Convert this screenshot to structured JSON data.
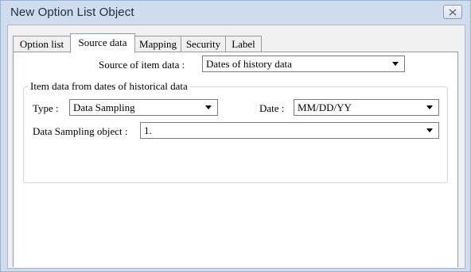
{
  "window": {
    "title": "New Option List Object"
  },
  "tabs": [
    {
      "label": "Option list",
      "active": false
    },
    {
      "label": "Source data",
      "active": true
    },
    {
      "label": "Mapping",
      "active": false
    },
    {
      "label": "Security",
      "active": false
    },
    {
      "label": "Label",
      "active": false
    }
  ],
  "source": {
    "label": "Source of item data :",
    "value": "Dates of history data"
  },
  "group": {
    "title": "Item data from dates of historical data",
    "type_label": "Type :",
    "type_value": "Data Sampling",
    "date_label": "Date :",
    "date_value": "MM/DD/YY",
    "sampling_label": "Data Sampling object :",
    "sampling_value": "1."
  },
  "icons": {
    "close": "close-icon",
    "dropdown": "chevron-down-icon"
  }
}
